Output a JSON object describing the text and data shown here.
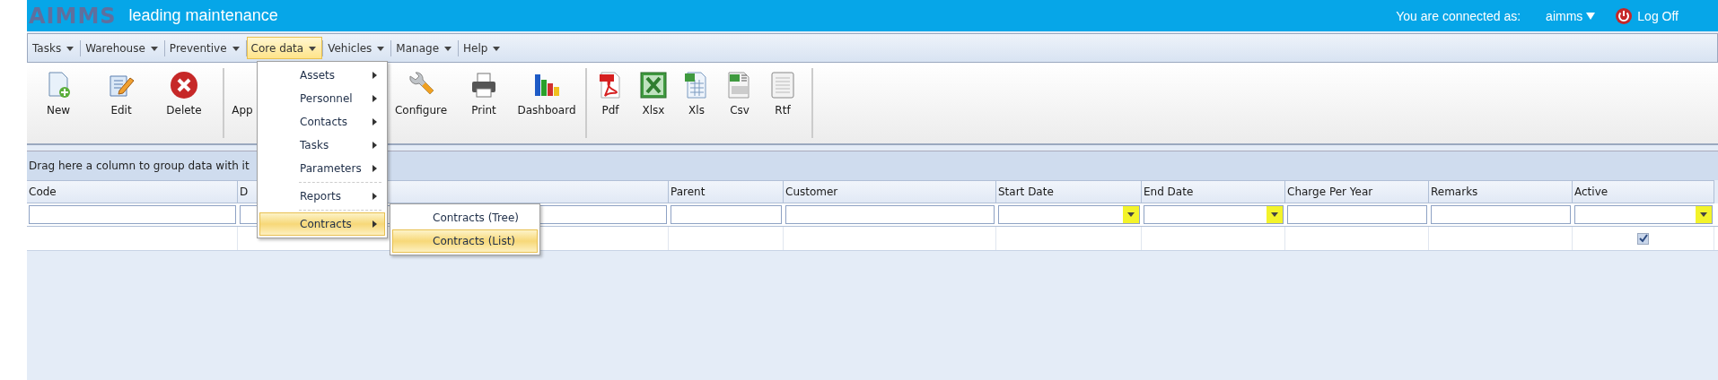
{
  "header": {
    "logo": "AIMMS",
    "tagline": "leading maintenance",
    "connected_label": "You are connected as:",
    "user": "aimms",
    "logoff": "Log Off"
  },
  "menu": [
    {
      "label": "Tasks",
      "selected": false
    },
    {
      "label": "Warehouse",
      "selected": false
    },
    {
      "label": "Preventive",
      "selected": false
    },
    {
      "label": "Core data",
      "selected": true
    },
    {
      "label": "Vehicles",
      "selected": false
    },
    {
      "label": "Manage",
      "selected": false
    },
    {
      "label": "Help",
      "selected": false
    }
  ],
  "toolbar": [
    {
      "buttons": [
        {
          "label": "New",
          "kind": "new"
        },
        {
          "label": "Edit",
          "kind": "edit"
        },
        {
          "label": "Delete",
          "kind": "delete"
        }
      ]
    },
    {
      "buttons": [
        {
          "label": "App",
          "kind": "covered"
        },
        {
          "label": "Configure",
          "kind": "configure"
        },
        {
          "label": "Print",
          "kind": "print"
        },
        {
          "label": "Dashboard",
          "kind": "dashboard"
        }
      ]
    },
    {
      "buttons": [
        {
          "label": "Pdf",
          "kind": "pdf"
        },
        {
          "label": "Xlsx",
          "kind": "xlsx"
        },
        {
          "label": "Xls",
          "kind": "xls"
        },
        {
          "label": "Csv",
          "kind": "csv"
        },
        {
          "label": "Rtf",
          "kind": "rtf"
        }
      ]
    }
  ],
  "dropdown": {
    "items": [
      {
        "kind": "item",
        "label": "Assets",
        "selected": false
      },
      {
        "kind": "item",
        "label": "Personnel",
        "selected": false
      },
      {
        "kind": "item",
        "label": "Contacts",
        "selected": false
      },
      {
        "kind": "item",
        "label": "Tasks",
        "selected": false
      },
      {
        "kind": "item",
        "label": "Parameters",
        "selected": false
      },
      {
        "kind": "separator"
      },
      {
        "kind": "item",
        "label": "Reports",
        "selected": false
      },
      {
        "kind": "separator"
      },
      {
        "kind": "item",
        "label": "Contracts",
        "selected": true
      }
    ],
    "submenu": [
      {
        "label": "Contracts (Tree)",
        "selected": false
      },
      {
        "label": "Contracts (List)",
        "selected": true
      }
    ]
  },
  "grid": {
    "group_hint": "Drag here a column to group data with it",
    "columns": [
      {
        "header": "Code",
        "kind": "text"
      },
      {
        "header": "D",
        "kind": "text"
      },
      {
        "header": "Parent",
        "kind": "text"
      },
      {
        "header": "Customer",
        "kind": "text"
      },
      {
        "header": "Start Date",
        "kind": "dropdown"
      },
      {
        "header": "End Date",
        "kind": "dropdown"
      },
      {
        "header": "Charge Per Year",
        "kind": "text"
      },
      {
        "header": "Remarks",
        "kind": "text"
      },
      {
        "header": "Active",
        "kind": "dropdown"
      }
    ],
    "rows": [
      {
        "active": true
      }
    ]
  }
}
